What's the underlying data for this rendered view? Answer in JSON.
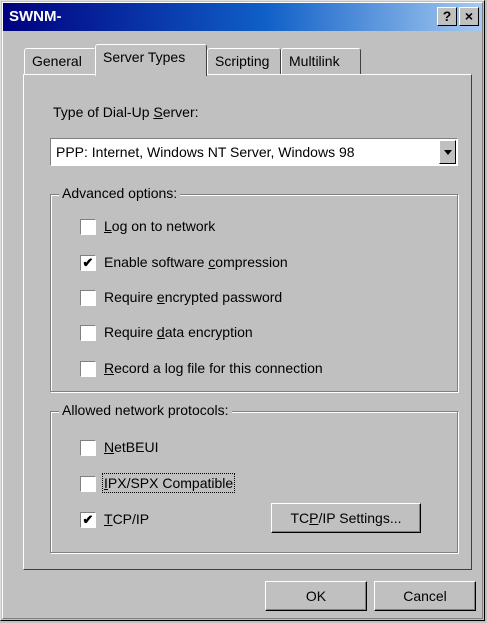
{
  "window": {
    "title": "SWNM-",
    "help_label": "?",
    "close_label": "×"
  },
  "tabs": [
    {
      "label": "General"
    },
    {
      "label": "Server Types",
      "active": true
    },
    {
      "label": "Scripting"
    },
    {
      "label": "Multilink"
    }
  ],
  "server_type": {
    "label_pre": "Type of Dial-Up ",
    "label_u": "S",
    "label_post": "erver:",
    "value": "PPP: Internet, Windows NT Server, Windows 98"
  },
  "advanced": {
    "title": "Advanced options:",
    "options": [
      {
        "pre": "",
        "u": "L",
        "post": "og on to network",
        "checked": false,
        "mark": ""
      },
      {
        "pre": "Enable software ",
        "u": "c",
        "post": "ompression",
        "checked": true,
        "mark": "✔"
      },
      {
        "pre": "Require ",
        "u": "e",
        "post": "ncrypted password",
        "checked": false,
        "mark": ""
      },
      {
        "pre": "Require ",
        "u": "d",
        "post": "ata encryption",
        "checked": false,
        "mark": ""
      },
      {
        "pre": "",
        "u": "R",
        "post": "ecord a log file for this connection",
        "checked": false,
        "mark": ""
      }
    ]
  },
  "protocols": {
    "title": "Allowed network protocols:",
    "options": [
      {
        "pre": "",
        "u": "N",
        "post": "etBEUI",
        "checked": false,
        "mark": ""
      },
      {
        "pre": "",
        "u": "I",
        "post": "PX/SPX Compatible",
        "checked": false,
        "mark": ""
      },
      {
        "pre": "",
        "u": "T",
        "post": "CP/IP",
        "checked": true,
        "mark": "✔"
      }
    ],
    "settings_pre": "TC",
    "settings_u": "P",
    "settings_post": "/IP Settings..."
  },
  "buttons": {
    "ok": "OK",
    "cancel": "Cancel"
  }
}
